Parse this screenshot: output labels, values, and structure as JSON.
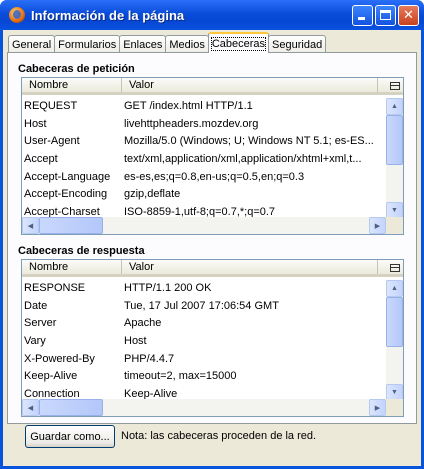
{
  "window": {
    "title": "Información de la página"
  },
  "tabs": [
    "General",
    "Formularios",
    "Enlaces",
    "Medios",
    "Cabeceras",
    "Seguridad"
  ],
  "request": {
    "title": "Cabeceras de petición",
    "col_name": "Nombre",
    "col_value": "Valor",
    "rows": [
      {
        "name": "REQUEST",
        "value": "GET /index.html HTTP/1.1"
      },
      {
        "name": "Host",
        "value": "livehttpheaders.mozdev.org"
      },
      {
        "name": "User-Agent",
        "value": "Mozilla/5.0 (Windows; U; Windows NT 5.1; es-ES..."
      },
      {
        "name": "Accept",
        "value": "text/xml,application/xml,application/xhtml+xml,t..."
      },
      {
        "name": "Accept-Language",
        "value": "es-es,es;q=0.8,en-us;q=0.5,en;q=0.3"
      },
      {
        "name": "Accept-Encoding",
        "value": "gzip,deflate"
      },
      {
        "name": "Accept-Charset",
        "value": "ISO-8859-1,utf-8;q=0.7,*;q=0.7"
      }
    ]
  },
  "response": {
    "title": "Cabeceras de respuesta",
    "col_name": "Nombre",
    "col_value": "Valor",
    "rows": [
      {
        "name": "RESPONSE",
        "value": "HTTP/1.1 200 OK"
      },
      {
        "name": "Date",
        "value": "Tue, 17 Jul 2007 17:06:54 GMT"
      },
      {
        "name": "Server",
        "value": "Apache"
      },
      {
        "name": "Vary",
        "value": "Host"
      },
      {
        "name": "X-Powered-By",
        "value": "PHP/4.4.7"
      },
      {
        "name": "Keep-Alive",
        "value": "timeout=2, max=15000"
      },
      {
        "name": "Connection",
        "value": "Keep-Alive"
      }
    ]
  },
  "footer": {
    "save_label": "Guardar como...",
    "note": "Nota: las cabeceras proceden de la red."
  }
}
